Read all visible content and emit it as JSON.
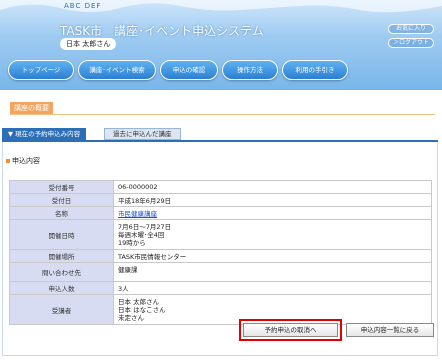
{
  "header": {
    "decoration": "ABC DEF",
    "title": "TASK市　講座･イベント申込システム",
    "user": "日本 太郎さん",
    "buttons": [
      "お気に入り",
      "＞ログアウト"
    ]
  },
  "nav": [
    "トップページ",
    "講座･イベント検索",
    "申込の確認",
    "操作方法",
    "利用の手引き"
  ],
  "section_title": "講座の概要",
  "tabs": {
    "active": "▼ 現在の予約申込み内容",
    "inactive": "過去に申込んだ講座"
  },
  "application_heading": "申込内容",
  "rows": [
    {
      "label": "受付番号",
      "value": "06-0000002"
    },
    {
      "label": "受付日",
      "value": "平成18年6月29日"
    },
    {
      "label": "名称",
      "value": "市民健康講座"
    },
    {
      "label": "開催日時",
      "value_lines": [
        "7月6日～7月27日",
        "毎週木曜･全4回",
        "19時から"
      ]
    },
    {
      "label": "開催場所",
      "value": "TASK市民情報センター"
    },
    {
      "label": "問い合わせ先",
      "value": "健康課"
    },
    {
      "label": "申込人数",
      "value": "3人"
    },
    {
      "label": "受講者",
      "value_lines": [
        "日本 太郎さん",
        "日本 はなこさん",
        "未定さん"
      ]
    }
  ],
  "buttons": {
    "cancel": "予約申込の取消へ",
    "back": "申込内容一覧に戻る"
  },
  "colors": {
    "accent": "#2c6fb7",
    "highlight": "#e00000",
    "label_bg": "#d7dcf2",
    "section_tag": "#f4a460"
  }
}
